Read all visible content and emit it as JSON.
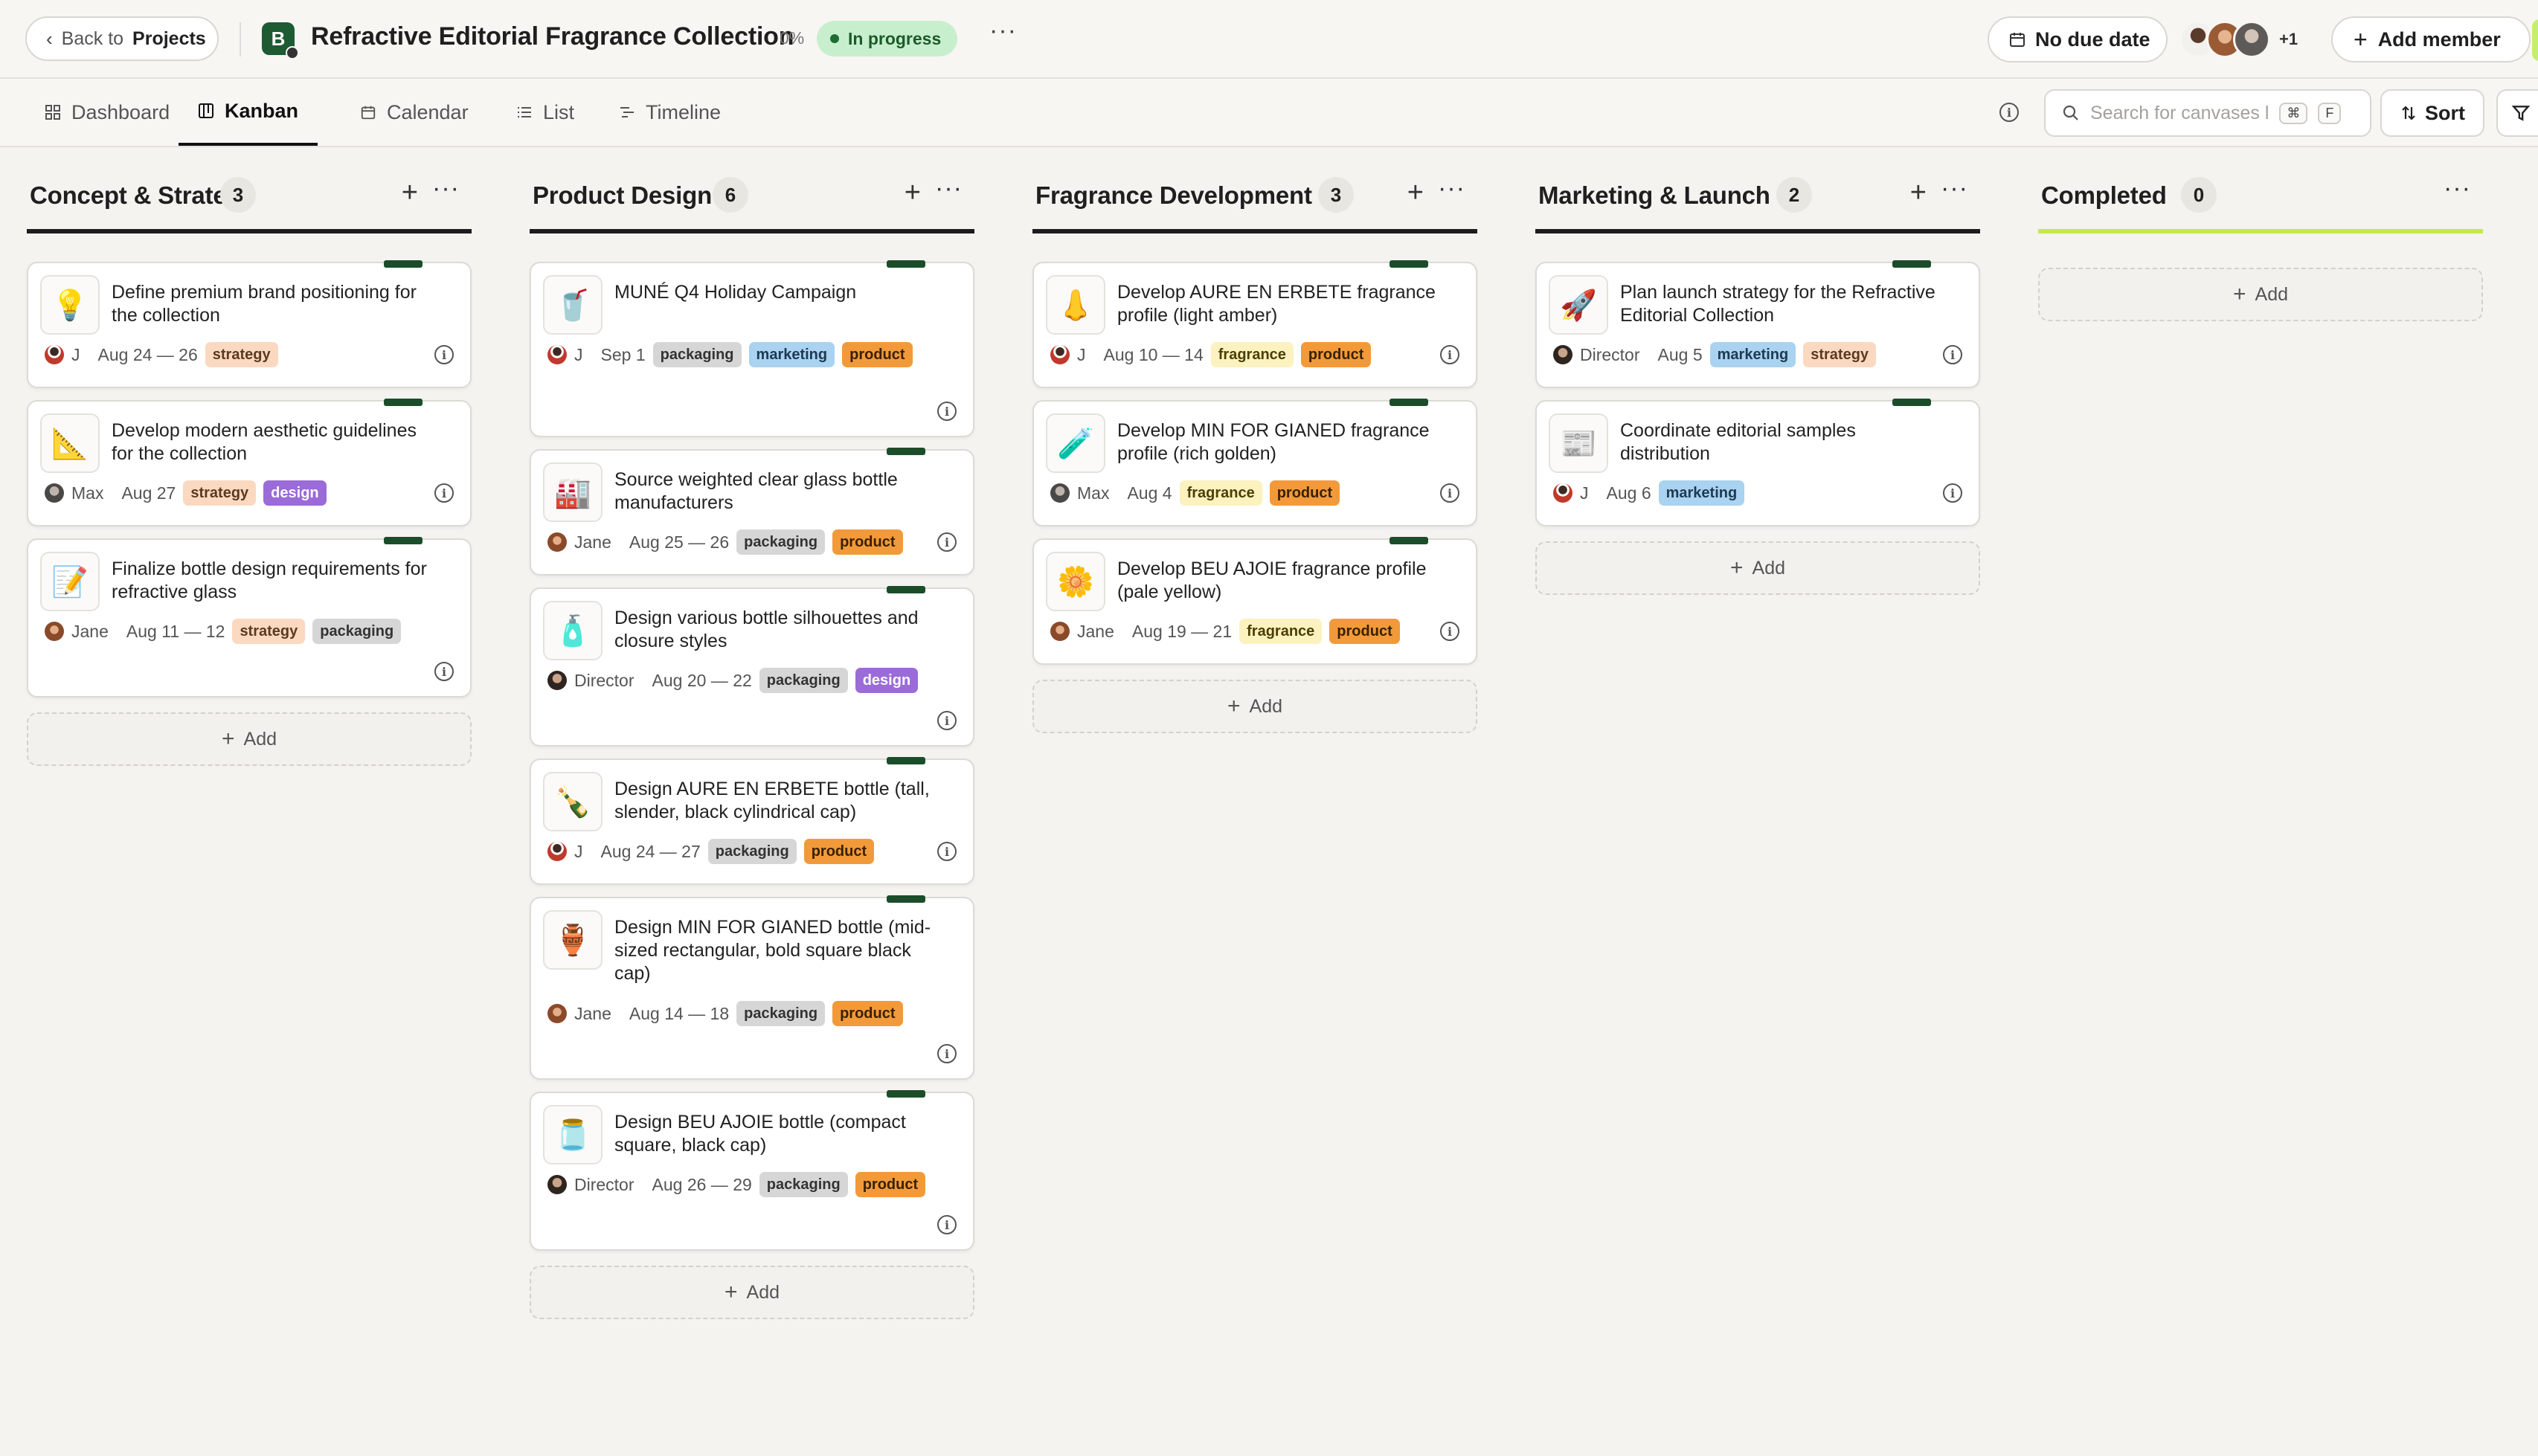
{
  "header": {
    "back_prefix": "Back to",
    "back_target": "Projects",
    "logo_letter": "B",
    "project_title": "Refractive Editorial Fragrance Collection",
    "progress": "0%",
    "status": "In progress",
    "more": "···",
    "due_date": "No due date",
    "extra_members": "+1",
    "add_member": "Add member"
  },
  "nav": {
    "tabs": [
      {
        "label": "Dashboard",
        "icon": "grid-icon"
      },
      {
        "label": "Kanban",
        "icon": "kanban-icon"
      },
      {
        "label": "Calendar",
        "icon": "calendar-icon"
      },
      {
        "label": "List",
        "icon": "list-icon"
      },
      {
        "label": "Timeline",
        "icon": "timeline-icon"
      }
    ],
    "active_tab": "Kanban",
    "search_placeholder": "Search for canvases l",
    "search_kbd_1": "⌘",
    "search_kbd_2": "F",
    "sort": "Sort"
  },
  "tag_colors": {
    "strategy": {
      "bg": "#fbd9c0",
      "fg": "#5a3a20"
    },
    "design": {
      "bg": "#9b6bd8",
      "fg": "#ffffff"
    },
    "packaging": {
      "bg": "#d6d6d6",
      "fg": "#333333"
    },
    "marketing": {
      "bg": "#a9d3f0",
      "fg": "#1e3a52"
    },
    "product": {
      "bg": "#f29a3a",
      "fg": "#3a2000"
    },
    "fragrance": {
      "bg": "#fcf2bf",
      "fg": "#4a3e00"
    }
  },
  "add_label": "Add",
  "columns": [
    {
      "title": "Concept & Strategy",
      "count": "3",
      "cards": [
        {
          "icon": "💡",
          "title": "Define premium brand positioning for the collection",
          "assignee": "J",
          "date": "Aug 24 — 26",
          "tags": [
            "strategy"
          ]
        },
        {
          "icon": "📐",
          "title": "Develop modern aesthetic guidelines for the collection",
          "assignee": "Max",
          "date": "Aug 27",
          "tags": [
            "strategy",
            "design"
          ]
        },
        {
          "icon": "📝",
          "title": "Finalize bottle design requirements for refractive glass",
          "assignee": "Jane",
          "date": "Aug 11 — 12",
          "tags": [
            "strategy",
            "packaging"
          ]
        }
      ]
    },
    {
      "title": "Product Design",
      "count": "6",
      "cards": [
        {
          "icon": "🥤",
          "title": "MUNÉ Q4 Holiday Campaign",
          "assignee": "J",
          "date": "Sep 1",
          "tags": [
            "packaging",
            "marketing",
            "product"
          ]
        },
        {
          "icon": "🏭",
          "title": "Source weighted clear glass bottle manufacturers",
          "assignee": "Jane",
          "date": "Aug 25 — 26",
          "tags": [
            "packaging",
            "product"
          ]
        },
        {
          "icon": "🧴",
          "title": "Design various bottle silhouettes and closure styles",
          "assignee": "Director",
          "date": "Aug 20 — 22",
          "tags": [
            "packaging",
            "design"
          ]
        },
        {
          "icon": "🍾",
          "title": "Design AURE EN ERBETE bottle (tall, slender, black cylindrical cap)",
          "assignee": "J",
          "date": "Aug 24 — 27",
          "tags": [
            "packaging",
            "product"
          ]
        },
        {
          "icon": "🏺",
          "title": "Design MIN FOR GIANED bottle (mid-sized rectangular, bold square black cap)",
          "assignee": "Jane",
          "date": "Aug 14 — 18",
          "tags": [
            "packaging",
            "product"
          ]
        },
        {
          "icon": "🫙",
          "title": "Design BEU AJOIE bottle (compact square, black cap)",
          "assignee": "Director",
          "date": "Aug 26 — 29",
          "tags": [
            "packaging",
            "product"
          ]
        }
      ]
    },
    {
      "title": "Fragrance Development",
      "count": "3",
      "cards": [
        {
          "icon": "👃",
          "title": "Develop AURE EN ERBETE fragrance profile (light amber)",
          "assignee": "J",
          "date": "Aug 10 — 14",
          "tags": [
            "fragrance",
            "product"
          ]
        },
        {
          "icon": "🧪",
          "title": "Develop MIN FOR GIANED fragrance profile (rich golden)",
          "assignee": "Max",
          "date": "Aug 4",
          "tags": [
            "fragrance",
            "product"
          ]
        },
        {
          "icon": "🌼",
          "title": "Develop BEU AJOIE fragrance profile (pale yellow)",
          "assignee": "Jane",
          "date": "Aug 19 — 21",
          "tags": [
            "fragrance",
            "product"
          ]
        }
      ]
    },
    {
      "title": "Marketing & Launch",
      "count": "2",
      "cards": [
        {
          "icon": "🚀",
          "title": "Plan launch strategy for the Refractive Editorial Collection",
          "assignee": "Director",
          "date": "Aug 5",
          "tags": [
            "marketing",
            "strategy"
          ]
        },
        {
          "icon": "📰",
          "title": "Coordinate editorial samples distribution",
          "assignee": "J",
          "date": "Aug 6",
          "tags": [
            "marketing"
          ]
        }
      ]
    },
    {
      "title": "Completed",
      "count": "0",
      "cards": []
    }
  ]
}
